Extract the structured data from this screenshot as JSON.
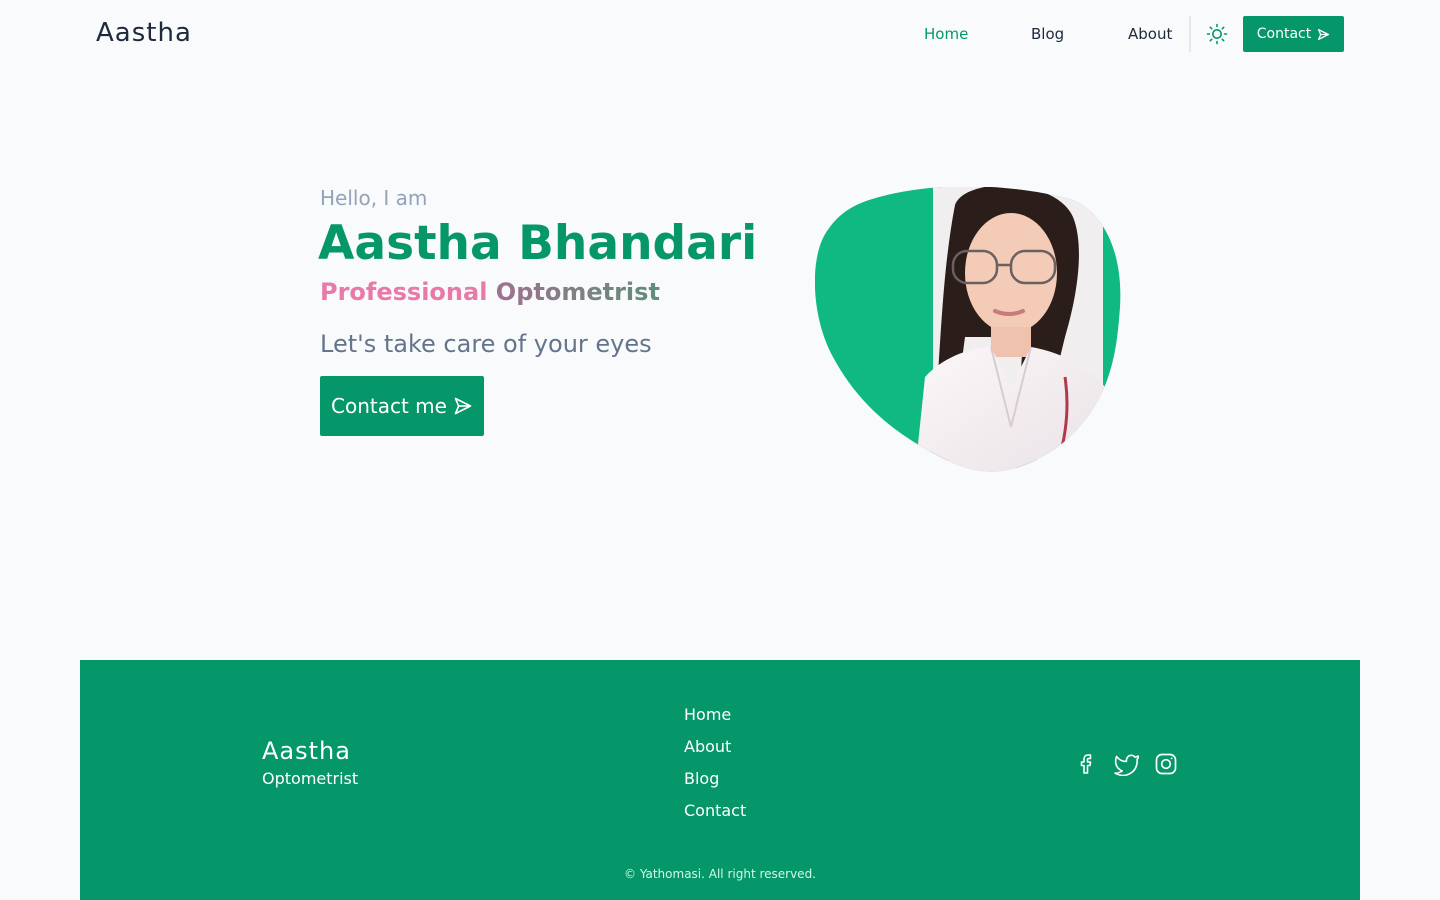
{
  "header": {
    "logo": "Aastha",
    "nav": [
      "Home",
      "Blog",
      "About"
    ],
    "active_nav": "Home",
    "contact_label": "Contact",
    "send_icon": "send-icon",
    "theme_icon": "sun-icon"
  },
  "hero": {
    "greeting": "Hello, I am",
    "name": "Aastha Bhandari",
    "role_first": "Professional",
    "role_second": "Optometrist",
    "tagline": "Let's take care of your eyes",
    "cta_label": "Contact me",
    "portrait_icon": "profile-photo"
  },
  "footer": {
    "brand": "Aastha",
    "subtitle": "Optometrist",
    "links": [
      "Home",
      "About",
      "Blog",
      "Contact"
    ],
    "social_icons": [
      "facebook-icon",
      "twitter-icon",
      "instagram-icon"
    ],
    "copyright": "© Yathomasi. All right reserved."
  },
  "colors": {
    "accent": "#059669",
    "blob": "#10b981",
    "background": "#f8fafc",
    "muted": "#94a3b8",
    "pink": "#e879a9"
  }
}
